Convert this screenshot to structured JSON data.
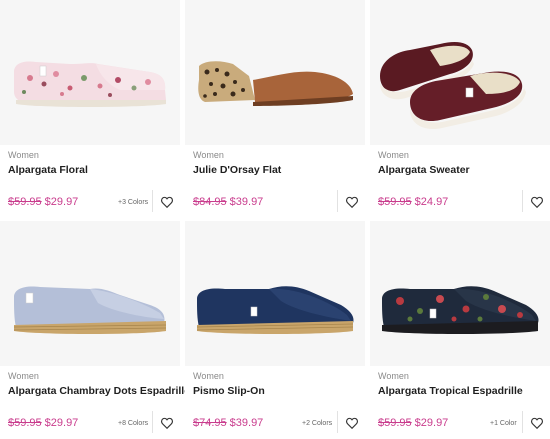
{
  "products": [
    {
      "category": "Women",
      "name": "Alpargata Floral",
      "old_price": "$59.95",
      "new_price": "$29.97",
      "colors": "+3 Colors"
    },
    {
      "category": "Women",
      "name": "Julie D'Orsay Flat",
      "old_price": "$84.95",
      "new_price": "$39.97",
      "colors": ""
    },
    {
      "category": "Women",
      "name": "Alpargata Sweater",
      "old_price": "$59.95",
      "new_price": "$24.97",
      "colors": ""
    },
    {
      "category": "Women",
      "name": "Alpargata Chambray Dots Espadrille",
      "old_price": "$59.95",
      "new_price": "$29.97",
      "colors": "+8 Colors"
    },
    {
      "category": "Women",
      "name": "Pismo Slip-On",
      "old_price": "$74.95",
      "new_price": "$39.97",
      "colors": "+2 Colors"
    },
    {
      "category": "Women",
      "name": "Alpargata Tropical Espadrille",
      "old_price": "$59.95",
      "new_price": "$29.97",
      "colors": "+1 Color"
    }
  ],
  "icons": {
    "wishlist": "heart-outline-icon"
  },
  "colors": {
    "sale_price": "#c93c8d",
    "card_bg": "#f6f6f6"
  }
}
